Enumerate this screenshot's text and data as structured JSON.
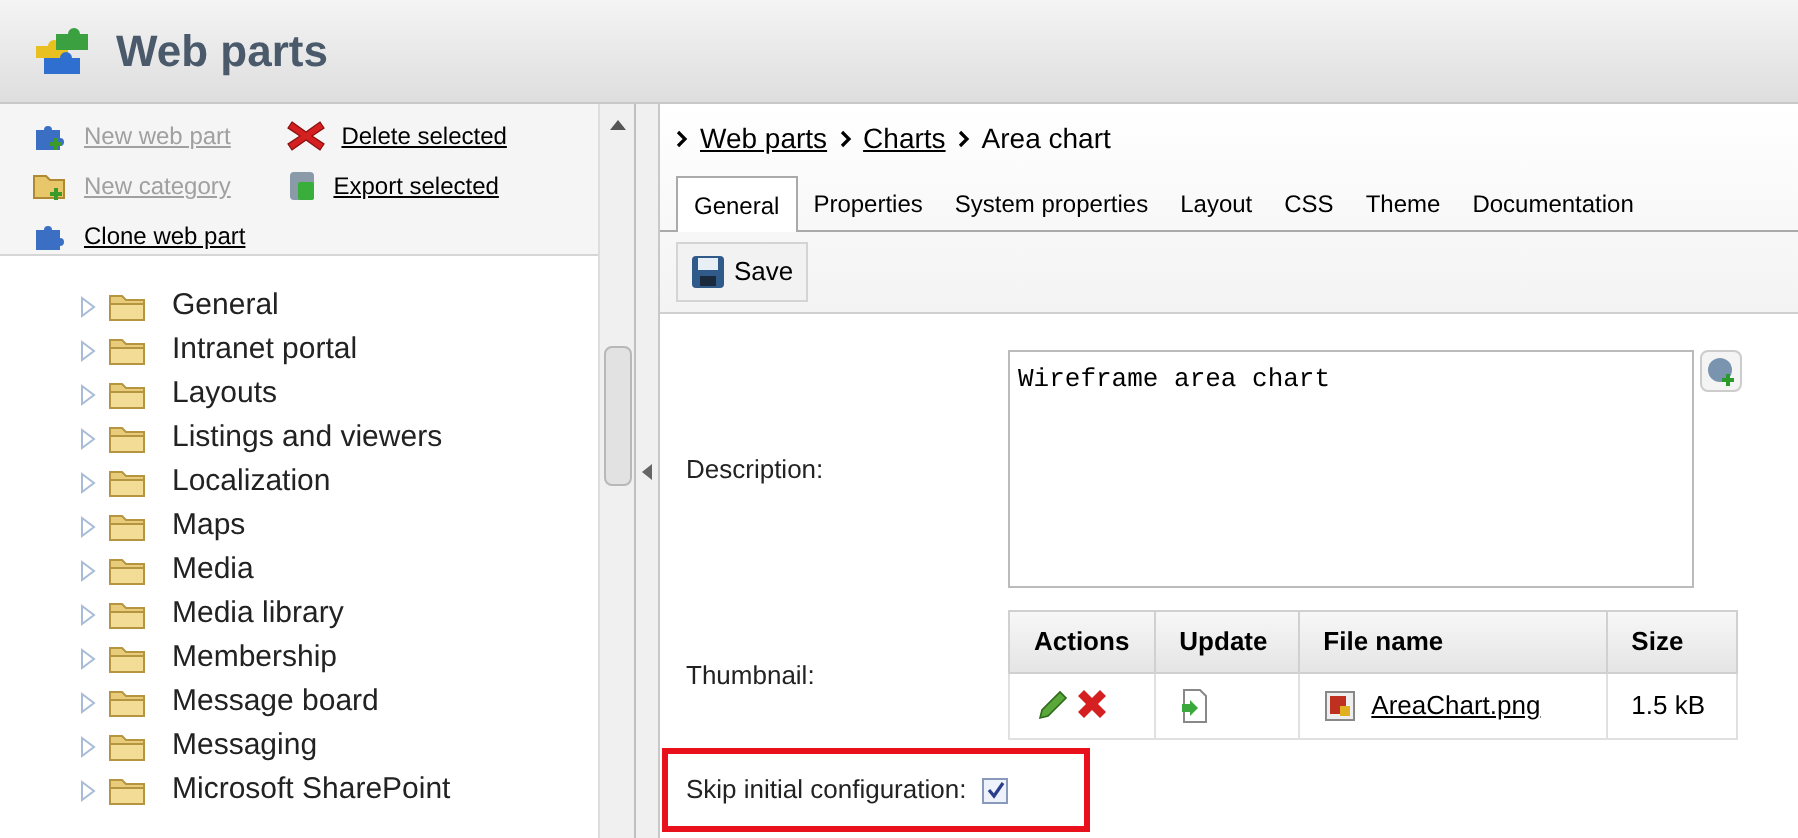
{
  "header": {
    "title": "Web parts"
  },
  "left_toolbar": {
    "actions": [
      {
        "label": "New web part",
        "disabled": true,
        "kind": "newpart"
      },
      {
        "label": "Delete selected",
        "disabled": false,
        "kind": "delete"
      },
      {
        "label": "New category",
        "disabled": true,
        "kind": "newcat"
      },
      {
        "label": "Export selected",
        "disabled": false,
        "kind": "export"
      },
      {
        "label": "Clone web part",
        "disabled": false,
        "kind": "clone"
      }
    ]
  },
  "tree": {
    "items": [
      {
        "label": "General"
      },
      {
        "label": "Intranet portal"
      },
      {
        "label": "Layouts"
      },
      {
        "label": "Listings and viewers"
      },
      {
        "label": "Localization"
      },
      {
        "label": "Maps"
      },
      {
        "label": "Media"
      },
      {
        "label": "Media library"
      },
      {
        "label": "Membership"
      },
      {
        "label": "Message board"
      },
      {
        "label": "Messaging"
      },
      {
        "label": "Microsoft SharePoint"
      }
    ]
  },
  "breadcrumb": [
    {
      "label": "Web parts",
      "link": true
    },
    {
      "label": "Charts",
      "link": true
    },
    {
      "label": "Area chart",
      "link": false
    }
  ],
  "tabs": [
    {
      "label": "General",
      "selected": true
    },
    {
      "label": "Properties",
      "selected": false
    },
    {
      "label": "System properties",
      "selected": false
    },
    {
      "label": "Layout",
      "selected": false
    },
    {
      "label": "CSS",
      "selected": false
    },
    {
      "label": "Theme",
      "selected": false
    },
    {
      "label": "Documentation",
      "selected": false
    }
  ],
  "save_button": "Save",
  "form": {
    "description_label": "Description:",
    "description_value": "Wireframe area chart",
    "thumbnail_label": "Thumbnail:",
    "thumbnail_table": {
      "columns": [
        "Actions",
        "Update",
        "File name",
        "Size"
      ],
      "rows": [
        {
          "file_name": "AreaChart.png",
          "size": "1.5 kB"
        }
      ]
    },
    "skip_label": "Skip initial configuration:",
    "skip_checked": true
  }
}
